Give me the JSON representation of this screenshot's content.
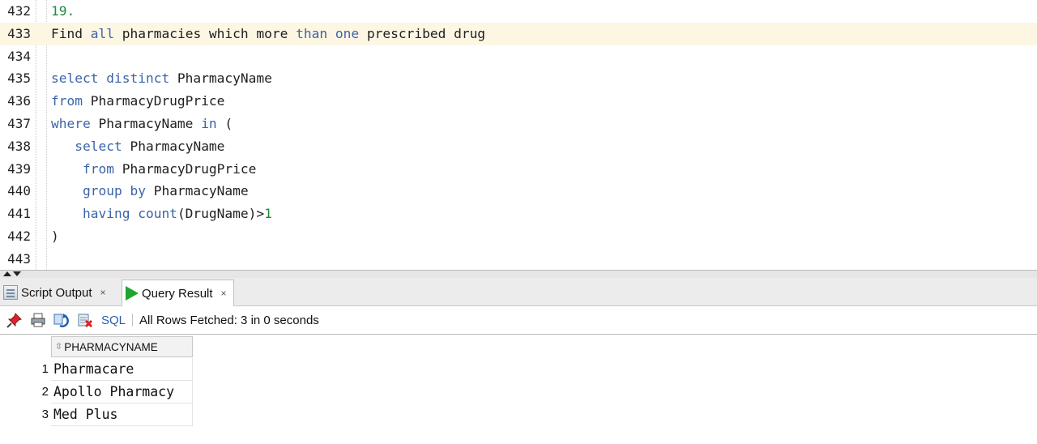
{
  "editor": {
    "lines": [
      {
        "num": "432",
        "tokens": [
          {
            "t": "19.",
            "c": "num"
          }
        ]
      },
      {
        "num": "433",
        "current": true,
        "tokens": [
          {
            "t": "Find ",
            "c": ""
          },
          {
            "t": "all",
            "c": "kw"
          },
          {
            "t": " pharmacies which more ",
            "c": ""
          },
          {
            "t": "than",
            "c": "kw"
          },
          {
            "t": " ",
            "c": ""
          },
          {
            "t": "one",
            "c": "kw"
          },
          {
            "t": " prescribed drug",
            "c": ""
          }
        ]
      },
      {
        "num": "434",
        "tokens": []
      },
      {
        "num": "435",
        "tokens": [
          {
            "t": "select distinct",
            "c": "kw"
          },
          {
            "t": " PharmacyName",
            "c": ""
          }
        ]
      },
      {
        "num": "436",
        "tokens": [
          {
            "t": "from",
            "c": "kw"
          },
          {
            "t": " PharmacyDrugPrice",
            "c": ""
          }
        ]
      },
      {
        "num": "437",
        "tokens": [
          {
            "t": "where",
            "c": "kw"
          },
          {
            "t": " PharmacyName ",
            "c": ""
          },
          {
            "t": "in",
            "c": "kw"
          },
          {
            "t": " (",
            "c": ""
          }
        ]
      },
      {
        "num": "438",
        "tokens": [
          {
            "t": "   ",
            "c": ""
          },
          {
            "t": "select",
            "c": "kw"
          },
          {
            "t": " PharmacyName",
            "c": ""
          }
        ]
      },
      {
        "num": "439",
        "tokens": [
          {
            "t": "    ",
            "c": ""
          },
          {
            "t": "from",
            "c": "kw"
          },
          {
            "t": " PharmacyDrugPrice",
            "c": ""
          }
        ]
      },
      {
        "num": "440",
        "tokens": [
          {
            "t": "    ",
            "c": ""
          },
          {
            "t": "group by",
            "c": "kw"
          },
          {
            "t": " PharmacyName",
            "c": ""
          }
        ]
      },
      {
        "num": "441",
        "tokens": [
          {
            "t": "    ",
            "c": ""
          },
          {
            "t": "having count",
            "c": "kw"
          },
          {
            "t": "(DrugName)>",
            "c": ""
          },
          {
            "t": "1",
            "c": "num"
          }
        ]
      },
      {
        "num": "442",
        "tokens": [
          {
            "t": ")",
            "c": ""
          }
        ]
      },
      {
        "num": "443",
        "tokens": []
      }
    ]
  },
  "tabs": {
    "script_output": {
      "label": "Script Output",
      "close": "×",
      "icon": "script-output-icon"
    },
    "query_result": {
      "label": "Query Result",
      "close": "×",
      "icon": "play-icon"
    }
  },
  "toolbar": {
    "sql_label": "SQL",
    "separator": "|",
    "status": "All Rows Fetched: 3 in 0 seconds",
    "icons": [
      "pin-icon",
      "print-icon",
      "refresh-icon",
      "clear-icon"
    ]
  },
  "results": {
    "column": "PHARMACYNAME",
    "rows": [
      {
        "num": "1",
        "value": "Pharmacare"
      },
      {
        "num": "2",
        "value": "Apollo Pharmacy"
      },
      {
        "num": "3",
        "value": "Med Plus"
      }
    ]
  },
  "colors": {
    "keyword": "#3b64a8",
    "number": "#1e8a3c",
    "current_line": "#fdf6e3",
    "run_green": "#1fa52e"
  }
}
